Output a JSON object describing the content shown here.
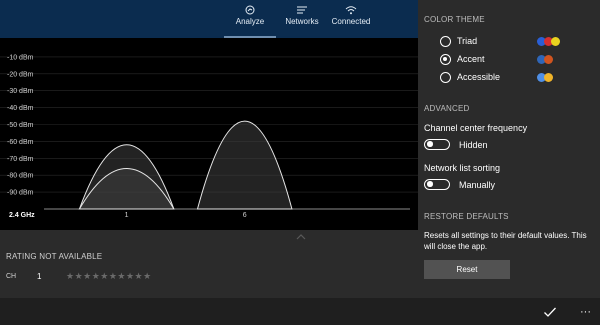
{
  "nav": {
    "tabs": [
      {
        "label": "Analyze",
        "icon": "analyze-icon",
        "active": true
      },
      {
        "label": "Networks",
        "icon": "networks-icon",
        "active": false
      },
      {
        "label": "Connected",
        "icon": "wifi-icon",
        "active": false
      }
    ]
  },
  "chart_data": {
    "type": "area",
    "band_label": "2.4 GHz",
    "y_ticks": [
      "-10 dBm",
      "-20 dBm",
      "-30 dBm",
      "-40 dBm",
      "-50 dBm",
      "-60 dBm",
      "-70 dBm",
      "-80 dBm",
      "-90 dBm"
    ],
    "ylim": [
      -100,
      0
    ],
    "x_ticks": [
      {
        "label": "1",
        "channel": 1
      },
      {
        "label": "6",
        "channel": 6
      }
    ],
    "xlim": [
      -2.5,
      13
    ],
    "grid": true,
    "series": [
      {
        "channel": 1,
        "peak_dbm": -62,
        "floor_dbm": -100
      },
      {
        "channel": 1,
        "peak_dbm": -76,
        "floor_dbm": -100
      },
      {
        "channel": 6,
        "peak_dbm": -48,
        "floor_dbm": -100
      }
    ],
    "fill_color": "#3f3f3f",
    "line_color": "#e6e6e6"
  },
  "info": {
    "rating_title": "RATING NOT AVAILABLE",
    "ch_label": "CH",
    "ch_value": "1",
    "stars": "★★★★★★★★★★",
    "star_count": 10,
    "rating_value": 0
  },
  "settings": {
    "color_theme_head": "COLOR THEME",
    "themes": [
      {
        "label": "Triad",
        "checked": false,
        "colors": [
          "#2a5fd6",
          "#d62f2f",
          "#e8d21f"
        ]
      },
      {
        "label": "Accent",
        "checked": true,
        "colors": [
          "#2f66b8",
          "#d0541f"
        ]
      },
      {
        "label": "Accessible",
        "checked": false,
        "colors": [
          "#4f8fe6",
          "#f0b429"
        ]
      }
    ],
    "advanced_head": "ADVANCED",
    "channel_center_label": "Channel center frequency",
    "channel_center_state": "Hidden",
    "network_sort_label": "Network list sorting",
    "network_sort_state": "Manually",
    "restore_head": "RESTORE DEFAULTS",
    "restore_text": "Resets all settings to their default values. This will close the app.",
    "reset_label": "Reset"
  },
  "appbar": {
    "check_icon": "check-icon",
    "more_label": "···"
  }
}
